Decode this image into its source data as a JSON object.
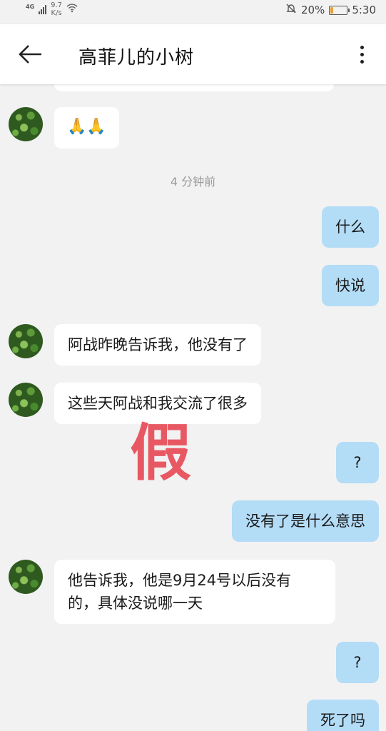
{
  "status_bar": {
    "network": "4G",
    "speed_value": "9.7",
    "speed_unit": "K/s",
    "battery_percent": "20%",
    "battery_level": 0.2,
    "time": "5:30"
  },
  "header": {
    "title": "高菲儿的小树"
  },
  "chat": {
    "timestamp": "4 分钟前",
    "messages": [
      {
        "side": "in",
        "text": "🙏🙏"
      },
      {
        "side": "out",
        "text": "什么"
      },
      {
        "side": "out",
        "text": "快说"
      },
      {
        "side": "in",
        "text": "阿战昨晚告诉我，他没有了"
      },
      {
        "side": "in",
        "text": "这些天阿战和我交流了很多"
      },
      {
        "side": "out",
        "text": "?"
      },
      {
        "side": "out",
        "text": "没有了是什么意思"
      },
      {
        "side": "in",
        "text_line1": "他告诉我，他是9月24号以后没有",
        "text_line2": "的，具体没说哪一天"
      },
      {
        "side": "out",
        "text": "?"
      },
      {
        "side": "out",
        "text": "死了吗"
      }
    ],
    "watermark": "假"
  },
  "colors": {
    "outgoing_bubble": "#b3dcf7",
    "incoming_bubble": "#ffffff",
    "background": "#f2f2f2",
    "watermark": "#e84c57"
  }
}
